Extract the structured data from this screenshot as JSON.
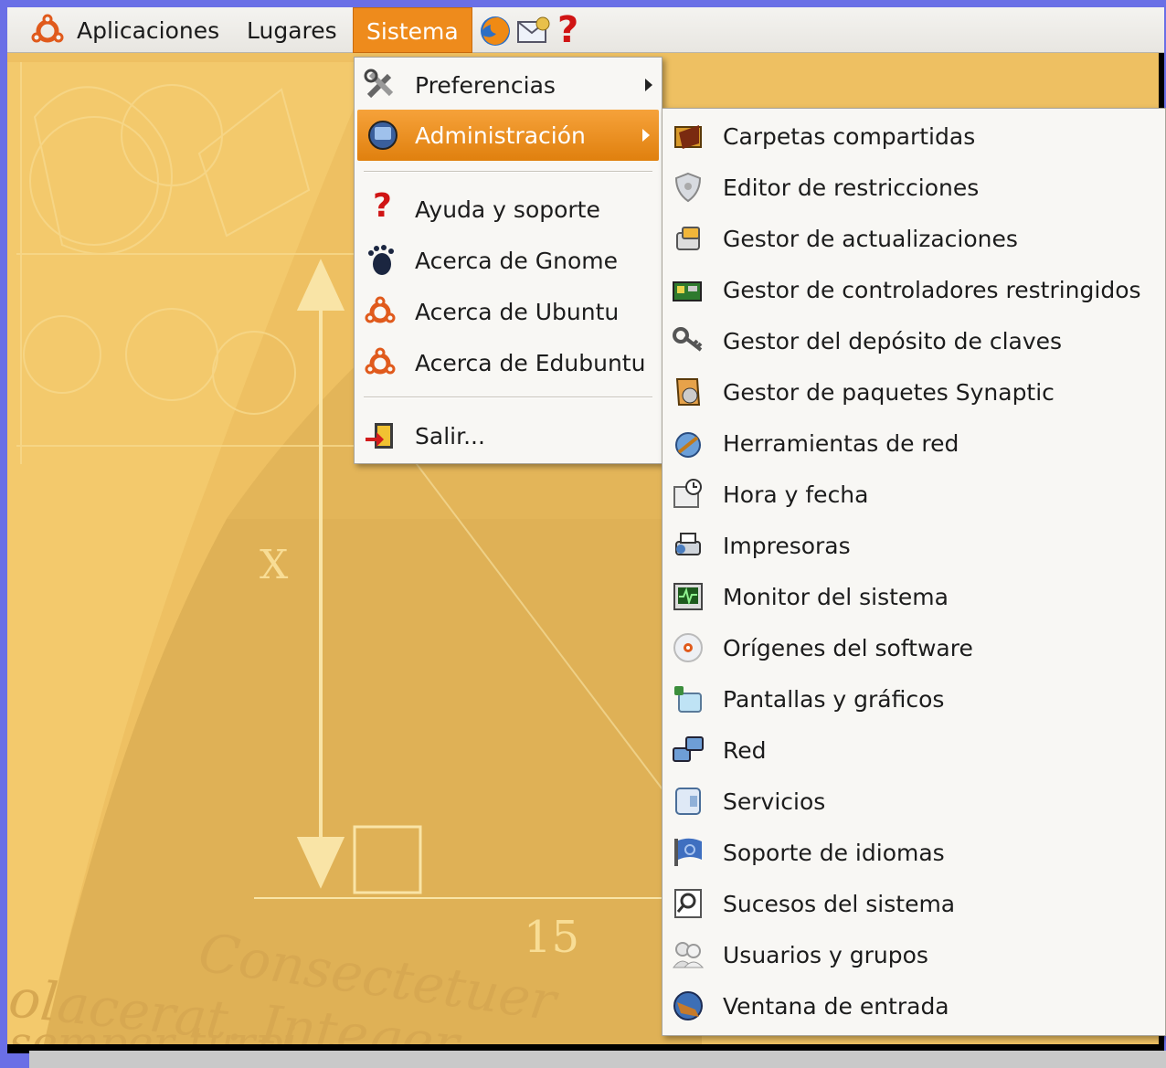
{
  "panel": {
    "menus": [
      "Aplicaciones",
      "Lugares",
      "Sistema"
    ],
    "launchers": [
      "firefox-icon",
      "mail-icon",
      "help-icon"
    ]
  },
  "sistema_menu": {
    "items": [
      {
        "label": "Preferencias",
        "icon": "preferences-icon",
        "submenu": true
      },
      {
        "label": "Administración",
        "icon": "administration-icon",
        "submenu": true,
        "active": true
      },
      {
        "label": "Ayuda y soporte",
        "icon": "help-icon"
      },
      {
        "label": "Acerca de Gnome",
        "icon": "gnome-foot-icon"
      },
      {
        "label": "Acerca de Ubuntu",
        "icon": "ubuntu-icon"
      },
      {
        "label": "Acerca de Edubuntu",
        "icon": "ubuntu-icon"
      },
      {
        "label": "Salir...",
        "icon": "logout-icon"
      }
    ]
  },
  "admin_menu": {
    "items": [
      {
        "label": "Carpetas compartidas",
        "icon": "shared-folder-icon"
      },
      {
        "label": "Editor de restricciones",
        "icon": "shield-icon"
      },
      {
        "label": "Gestor de actualizaciones",
        "icon": "update-icon"
      },
      {
        "label": "Gestor de controladores restringidos",
        "icon": "hardware-card-icon"
      },
      {
        "label": "Gestor del depósito de claves",
        "icon": "keyring-icon"
      },
      {
        "label": "Gestor de paquetes Synaptic",
        "icon": "synaptic-icon"
      },
      {
        "label": "Herramientas de red",
        "icon": "network-tools-icon"
      },
      {
        "label": "Hora y fecha",
        "icon": "clock-calendar-icon"
      },
      {
        "label": "Impresoras",
        "icon": "printer-icon"
      },
      {
        "label": "Monitor del sistema",
        "icon": "system-monitor-icon"
      },
      {
        "label": "Orígenes del software",
        "icon": "cd-icon"
      },
      {
        "label": "Pantallas y gráficos",
        "icon": "display-icon"
      },
      {
        "label": "Red",
        "icon": "network-icon"
      },
      {
        "label": "Servicios",
        "icon": "services-icon"
      },
      {
        "label": "Soporte de idiomas",
        "icon": "language-flag-icon"
      },
      {
        "label": "Sucesos del sistema",
        "icon": "log-viewer-icon"
      },
      {
        "label": "Usuarios y grupos",
        "icon": "users-icon"
      },
      {
        "label": "Ventana de entrada",
        "icon": "login-window-icon"
      }
    ]
  },
  "wallpaper": {
    "x_label": "X",
    "base_label": "15",
    "script_line_1": "Consectetuer",
    "script_line_2": "olacerat. Integer",
    "script_line_3": "semper turpi",
    "colors": {
      "bg": "#ecbf62",
      "accent": "#ee8b1c"
    }
  }
}
